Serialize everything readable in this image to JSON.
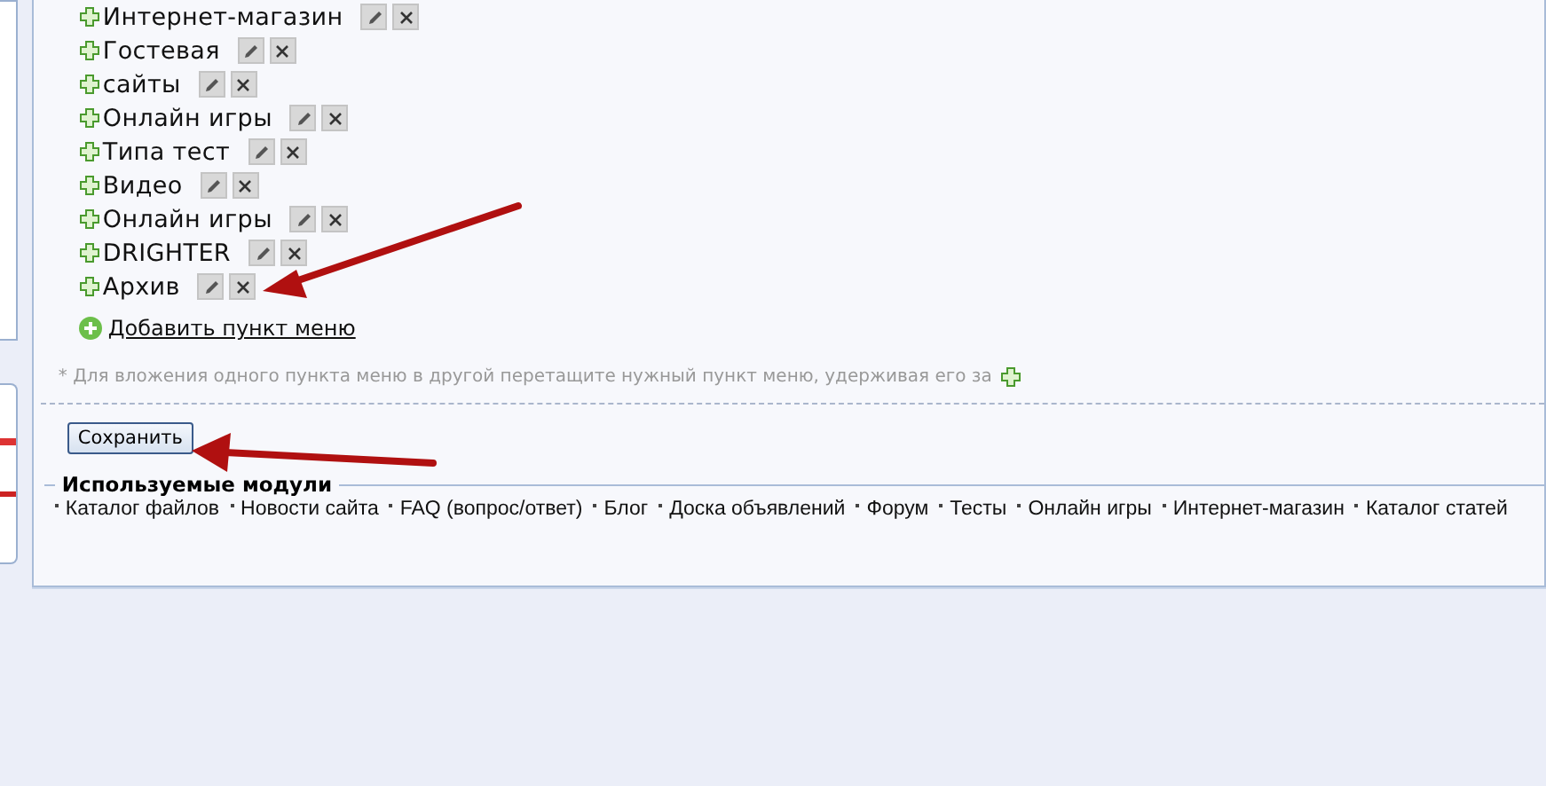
{
  "menu_items": [
    {
      "label": "Интернет-магазин"
    },
    {
      "label": "Гостевая"
    },
    {
      "label": "сайты"
    },
    {
      "label": "Онлайн игры"
    },
    {
      "label": "Типа тест"
    },
    {
      "label": "Видео"
    },
    {
      "label": "Онлайн игры"
    },
    {
      "label": "DRIGHTER"
    },
    {
      "label": "Архив"
    }
  ],
  "add_link": "Добавить пункт меню",
  "hint": "* Для вложения одного пункта меню в другой перетащите нужный пункт меню, удерживая его за",
  "save_button": "Сохранить",
  "modules": {
    "title": "Используемые модули",
    "items": [
      "Каталог файлов",
      "Новости сайта",
      "FAQ (вопрос/ответ)",
      "Блог",
      "Доска объявлений",
      "Форум",
      "Тесты",
      "Онлайн игры",
      "Интернет-магазин",
      "Каталог статей"
    ]
  }
}
